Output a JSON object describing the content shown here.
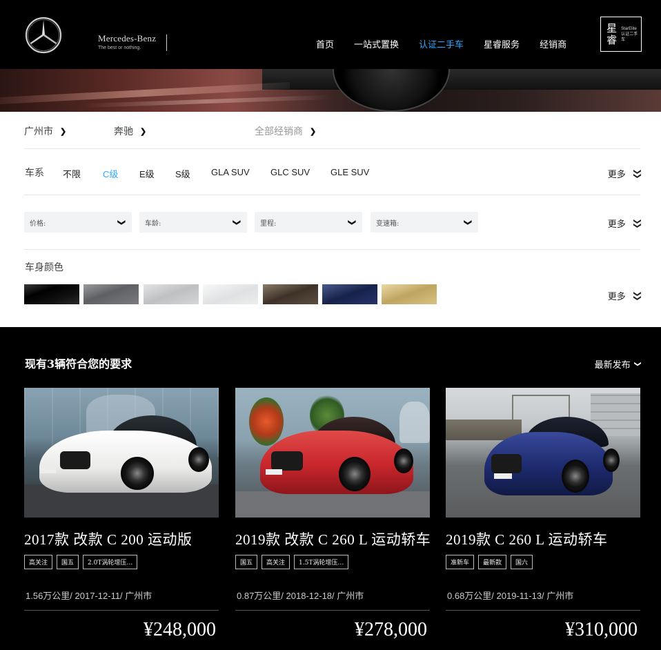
{
  "header": {
    "brand_name": "Mercedes-Benz",
    "brand_tagline": "The best or nothing.",
    "nav": [
      {
        "label": "首页",
        "active": false
      },
      {
        "label": "一站式置换",
        "active": false
      },
      {
        "label": "认证二手车",
        "active": true
      },
      {
        "label": "星睿服务",
        "active": false
      },
      {
        "label": "经销商",
        "active": false
      }
    ],
    "star_elite_cn": "星睿",
    "star_elite_en": "StarElite",
    "star_elite_sub": "认证二手车"
  },
  "filters": {
    "city": "广州市",
    "brand": "奔驰",
    "dealer": "全部经销商",
    "series_label": "车系",
    "series": [
      {
        "label": "不限",
        "active": false
      },
      {
        "label": "C级",
        "active": true
      },
      {
        "label": "E级",
        "active": false
      },
      {
        "label": "S级",
        "active": false
      },
      {
        "label": "GLA SUV",
        "active": false
      },
      {
        "label": "GLC SUV",
        "active": false
      },
      {
        "label": "GLE SUV",
        "active": false
      }
    ],
    "more_label": "更多",
    "selects": [
      {
        "placeholder": "价格:"
      },
      {
        "placeholder": "车龄:"
      },
      {
        "placeholder": "里程:"
      },
      {
        "placeholder": "变速箱:"
      }
    ],
    "color_label": "车身颜色",
    "colors": [
      {
        "name": "black",
        "hex": "#0b0b0b"
      },
      {
        "name": "dark-grey",
        "hex": "#6b6c6e"
      },
      {
        "name": "silver",
        "hex": "#c9cacc"
      },
      {
        "name": "white",
        "hex": "#e8e9ea"
      },
      {
        "name": "brown",
        "hex": "#5a4a3d"
      },
      {
        "name": "blue",
        "hex": "#1f2c55"
      },
      {
        "name": "gold",
        "hex": "#cdb67a"
      }
    ]
  },
  "results": {
    "title": "现有3辆符合您的要求",
    "sort_label": "最新发布",
    "cars": [
      {
        "title": "2017款 改款 C 200 运动版",
        "tags": [
          "高关注",
          "国五",
          "2.0T涡轮增压…"
        ],
        "meta": "1.56万公里/ 2017-12-11/ 广州市",
        "price": "¥248,000",
        "car_color": "#f1f1f0"
      },
      {
        "title": "2019款 改款 C 260 L 运动轿车",
        "tags": [
          "国五",
          "高关注",
          "1.5T涡轮增压…"
        ],
        "meta": "0.87万公里/ 2018-12-18/ 广州市",
        "price": "¥278,000",
        "car_color": "#c8262c"
      },
      {
        "title": "2019款 C 260 L 运动轿车",
        "tags": [
          "准新车",
          "最新款",
          "国六"
        ],
        "meta": "0.68万公里/ 2019-11-13/ 广州市",
        "price": "¥310,000",
        "car_color": "#1d2a6e"
      }
    ]
  }
}
